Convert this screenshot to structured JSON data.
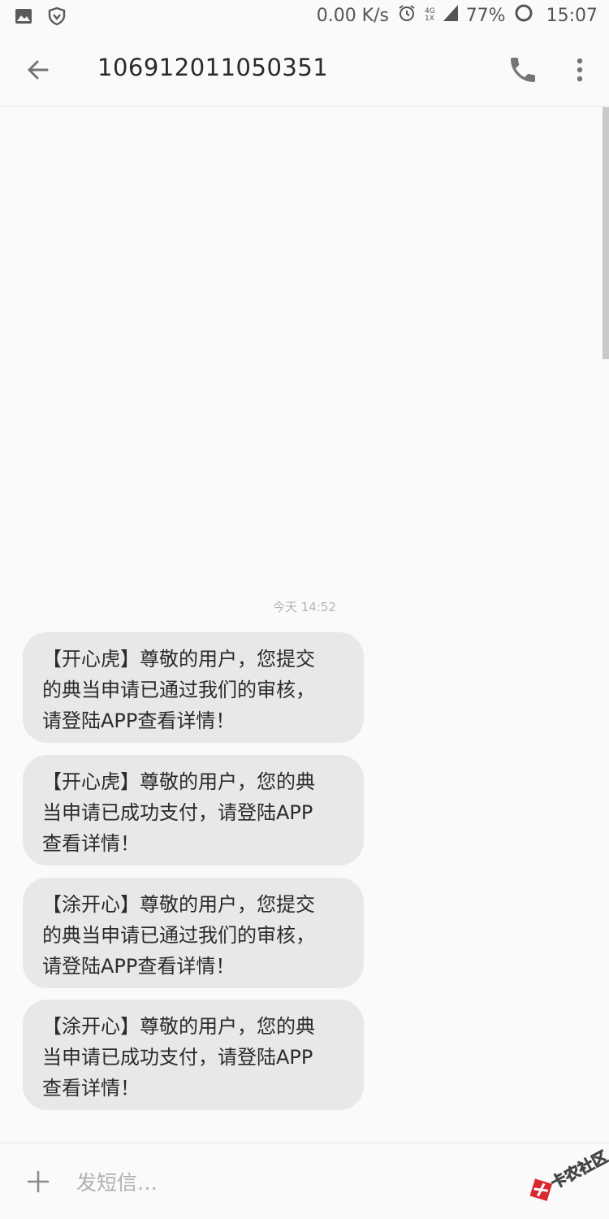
{
  "status_bar": {
    "net_speed": "0.00 K/s",
    "network_top": "4G",
    "network_bottom": "1X",
    "battery": "77%",
    "time": "15:07"
  },
  "header": {
    "title": "106912011050351",
    "icons": [
      "back-arrow-icon",
      "phone-icon",
      "more-vert-icon"
    ]
  },
  "conversation": {
    "timestamp": "今天 14:52",
    "messages": [
      {
        "lines": [
          "【开心虎】尊敬的用户，您提交",
          "的典当申请已通过我们的审核，",
          "请登陆APP查看详情！"
        ]
      },
      {
        "lines": [
          "【开心虎】尊敬的用户，您的典",
          "当申请已成功支付，请登陆APP",
          "查看详情！"
        ]
      },
      {
        "lines": [
          "【涂开心】尊敬的用户，您提交",
          "的典当申请已通过我们的审核，",
          "请登陆APP查看详情！"
        ]
      },
      {
        "lines": [
          "【涂开心】尊敬的用户，您的典",
          "当申请已成功支付，请登陆APP",
          "查看详情！"
        ]
      }
    ]
  },
  "compose": {
    "placeholder": "发短信…",
    "value": ""
  },
  "watermark": {
    "text": "卡农社区"
  },
  "colors": {
    "background": "#fafafa",
    "bubble": "#e8e8e8",
    "text": "#2b2b2b",
    "timestamp": "#b5b5b5",
    "icon": "#757575",
    "watermark_red": "#d9282f"
  }
}
